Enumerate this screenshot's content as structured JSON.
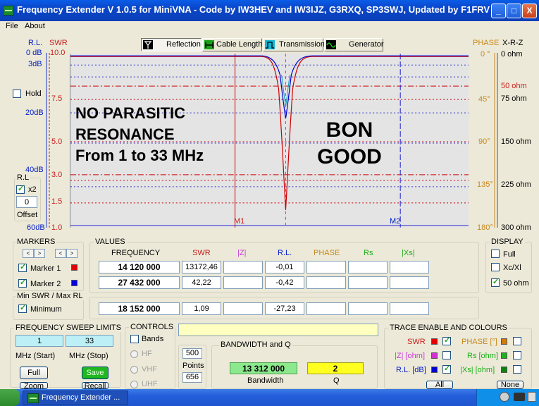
{
  "window": {
    "title": "Frequency Extender V 1.0.5  for MiniVNA  -  Code by IW3HEV and IW3IJZ, G3RXQ, SP3SWJ, Updated by F1FRV",
    "controls": [
      "_",
      "□",
      "X"
    ]
  },
  "menu": [
    "File",
    "About"
  ],
  "toolbar": [
    {
      "label": "Reflection",
      "icon": "antenna-icon",
      "active": true
    },
    {
      "label": "Cable Length",
      "icon": "cable-icon",
      "active": false
    },
    {
      "label": "Transmission",
      "icon": "filter-icon",
      "active": false
    },
    {
      "label": "Generator",
      "icon": "sine-icon",
      "active": false
    }
  ],
  "left_axis": {
    "rl_header": "R.L.",
    "swr_header": "SWR",
    "rl_labels": [
      "0 dB",
      "3dB",
      "20dB",
      "40dB",
      "60dB"
    ],
    "swr_labels": [
      "10.0",
      "7.5",
      "5.0",
      "3.0",
      "1.5",
      "1.0"
    ],
    "hold_label": "Hold",
    "hold_checked": false,
    "rl_group": "R.L",
    "x2_label": "x2",
    "x2_checked": true,
    "offset_value": "0",
    "offset_label": "Offset"
  },
  "right_axis": {
    "phase_header": "PHASE",
    "xrz_header": "X-R-Z",
    "phase_labels": [
      "0 °",
      "45°",
      "90°",
      "135°",
      "180°"
    ],
    "ohm_labels": [
      "0 ohm",
      "50 ohm",
      "75 ohm",
      "150 ohm",
      "225 ohm",
      "300 ohm"
    ]
  },
  "graph": {
    "annotation_left": [
      "NO PARASITIC",
      "RESONANCE",
      "From 1 to 33 MHz"
    ],
    "annotation_right": [
      "BON",
      "GOOD"
    ],
    "marker1_label": "M1",
    "marker2_label": "M2",
    "colors": {
      "swr": "#cc0000",
      "rl": "#0000cc",
      "grid_red": "#cc0000",
      "grid_blue": "#3333cc"
    }
  },
  "markers": {
    "title": "MARKERS",
    "spin": [
      "<",
      ">",
      "<",
      ">"
    ],
    "marker1_label": "Marker 1",
    "marker1_checked": true,
    "marker1_color": "#e00000",
    "marker2_label": "Marker 2",
    "marker2_checked": true,
    "marker2_color": "#0000e0"
  },
  "minswr": {
    "title": "Min SWR / Max RL",
    "label": "Minimum",
    "checked": true
  },
  "values": {
    "title": "VALUES",
    "headers": [
      "FREQUENCY",
      "SWR",
      "|Z|",
      "R.L.",
      "PHASE",
      "Rs",
      "|Xs|"
    ],
    "rows": [
      [
        "14 120 000",
        "13172,46",
        "",
        "-0,01",
        "",
        "",
        ""
      ],
      [
        "27 432 000",
        "42,22",
        "",
        "-0,42",
        "",
        "",
        ""
      ],
      [
        "18 152 000",
        "1,09",
        "",
        "-27,23",
        "",
        "",
        ""
      ]
    ]
  },
  "display": {
    "title": "DISPLAY",
    "options": [
      {
        "label": "Full",
        "checked": false
      },
      {
        "label": "Xc/Xl",
        "checked": false
      },
      {
        "label": "50 ohm",
        "checked": true
      }
    ]
  },
  "sweep": {
    "title": "FREQUENCY SWEEP LIMITS",
    "start": "1",
    "stop": "33",
    "start_label": "MHz (Start)",
    "stop_label": "MHz (Stop)",
    "full_label": "Full",
    "save_label": "Save",
    "zoom_label": "Zoom",
    "recall_label": "Recall"
  },
  "controls": {
    "title": "CONTROLS",
    "bands_label": "Bands",
    "bands_checked": false,
    "radios": [
      "HF",
      "VHF",
      "UHF"
    ],
    "points_value": "500",
    "points_label": "Points",
    "second_value": "656"
  },
  "bandwidth": {
    "title": "BANDWIDTH and Q",
    "bw_value": "13 312 000",
    "bw_label": "Bandwidth",
    "q_value": "2",
    "q_label": "Q"
  },
  "trace": {
    "title": "TRACE ENABLE AND COLOURS",
    "items": [
      {
        "label": "SWR",
        "color": "#e00000",
        "checked": true
      },
      {
        "label": "PHASE [°]",
        "color": "#d07a10",
        "checked": false
      },
      {
        "label": "|Z| [ohm]",
        "color": "#d030d0",
        "checked": false
      },
      {
        "label": "Rs [ohm]",
        "color": "#20b020",
        "checked": false
      },
      {
        "label": "R.L. [dB]",
        "color": "#0000d0",
        "checked": true
      },
      {
        "label": "|Xs| [ohm]",
        "color": "#108010",
        "checked": false
      }
    ],
    "all_label": "All",
    "none_label": "None"
  },
  "taskbar": {
    "item_label": "Frequency Extender ...",
    "lang": "FR"
  }
}
